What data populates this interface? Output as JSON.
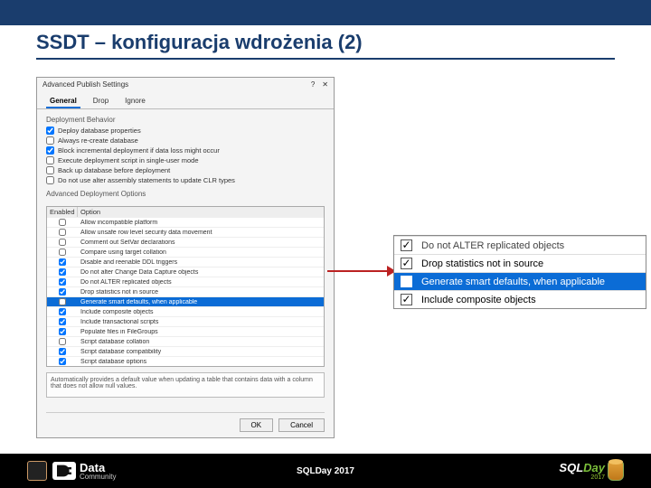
{
  "slide": {
    "title": "SSDT – konfiguracja wdrożenia (2)"
  },
  "dialog": {
    "title": "Advanced Publish Settings",
    "tabs": {
      "general": "General",
      "drop": "Drop",
      "ignore": "Ignore"
    },
    "section_behavior": "Deployment Behavior",
    "behavior": [
      {
        "checked": true,
        "label": "Deploy database properties"
      },
      {
        "checked": false,
        "label": "Always re-create database"
      },
      {
        "checked": true,
        "label": "Block incremental deployment if data loss might occur"
      },
      {
        "checked": false,
        "label": "Execute deployment script in single-user mode"
      },
      {
        "checked": false,
        "label": "Back up database before deployment"
      },
      {
        "checked": false,
        "label": "Do not use alter assembly statements to update CLR types"
      }
    ],
    "section_advanced": "Advanced Deployment Options",
    "thead": {
      "enabled": "Enabled",
      "option": "Option"
    },
    "options": [
      {
        "checked": false,
        "label": "Allow incompatible platform",
        "hl": false
      },
      {
        "checked": false,
        "label": "Allow unsafe row level security data movement",
        "hl": false
      },
      {
        "checked": false,
        "label": "Comment out SetVar declarations",
        "hl": false
      },
      {
        "checked": false,
        "label": "Compare using target collation",
        "hl": false
      },
      {
        "checked": true,
        "label": "Disable and reenable DDL triggers",
        "hl": false
      },
      {
        "checked": true,
        "label": "Do not alter Change Data Capture objects",
        "hl": false
      },
      {
        "checked": true,
        "label": "Do not ALTER replicated objects",
        "hl": false
      },
      {
        "checked": true,
        "label": "Drop statistics not in source",
        "hl": false
      },
      {
        "checked": false,
        "label": "Generate smart defaults, when applicable",
        "hl": true
      },
      {
        "checked": true,
        "label": "Include composite objects",
        "hl": false
      },
      {
        "checked": true,
        "label": "Include transactional scripts",
        "hl": false
      },
      {
        "checked": true,
        "label": "Populate files in FileGroups",
        "hl": false
      },
      {
        "checked": false,
        "label": "Script database collation",
        "hl": false
      },
      {
        "checked": true,
        "label": "Script database compatibility",
        "hl": false
      },
      {
        "checked": true,
        "label": "Script database options",
        "hl": false
      }
    ],
    "help": "Automatically provides a default value when updating a table that contains data with a column that does not allow null values.",
    "ok": "OK",
    "cancel": "Cancel"
  },
  "zoom": [
    {
      "checked": true,
      "label": "Do not ALTER replicated objects",
      "hl": false,
      "top": true
    },
    {
      "checked": true,
      "label": "Drop statistics not in source",
      "hl": false
    },
    {
      "checked": false,
      "label": "Generate smart defaults, when applicable",
      "hl": true
    },
    {
      "checked": true,
      "label": "Include composite objects",
      "hl": false
    }
  ],
  "footer": {
    "dc1": "Data",
    "dc2": "Community",
    "center": "SQLDay 2017",
    "sql": "SQL",
    "day": "Day",
    "year": "2017"
  }
}
